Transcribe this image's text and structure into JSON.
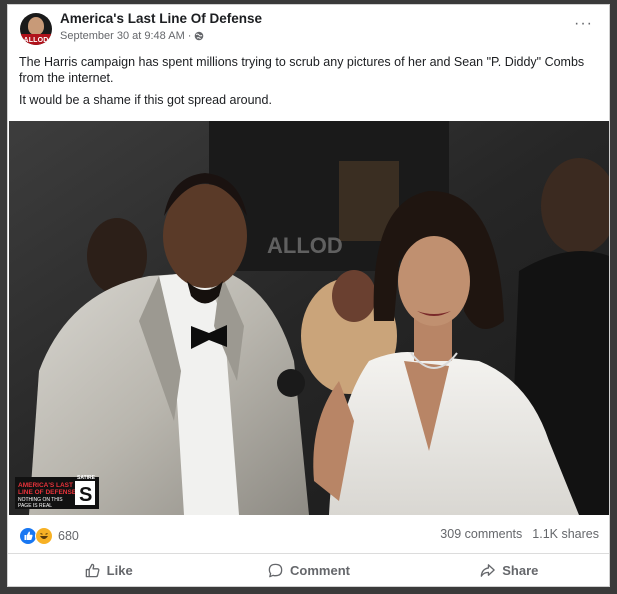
{
  "post": {
    "page_name": "America's Last Line Of Defense",
    "avatar_text": "ALLOD",
    "timestamp": "September 30 at 9:48 AM",
    "separator": "·",
    "more_label": "···",
    "text_1": "The Harris campaign has spent millions trying to scrub any pictures of her and Sean \"P. Diddy\" Combs from the internet.",
    "text_2": "It would be a shame if this got spread around."
  },
  "photo": {
    "watermark": "ALLOD",
    "badge_line1": "AMERICA'S LAST",
    "badge_line2": "LINE OF DEFENSE",
    "badge_line3": "NOTHING ON THIS",
    "badge_line4": "PAGE IS REAL",
    "badge_tag": "SATIRE",
    "badge_letter": "S"
  },
  "stats": {
    "reactions_count": "680",
    "comments": "309 comments",
    "shares": "1.1K shares"
  },
  "actions": {
    "like": "Like",
    "comment": "Comment",
    "share": "Share"
  },
  "colors": {
    "like_blue": "#1877f2",
    "haha_yellow": "#f7b125",
    "badge_red": "#b0121b"
  }
}
